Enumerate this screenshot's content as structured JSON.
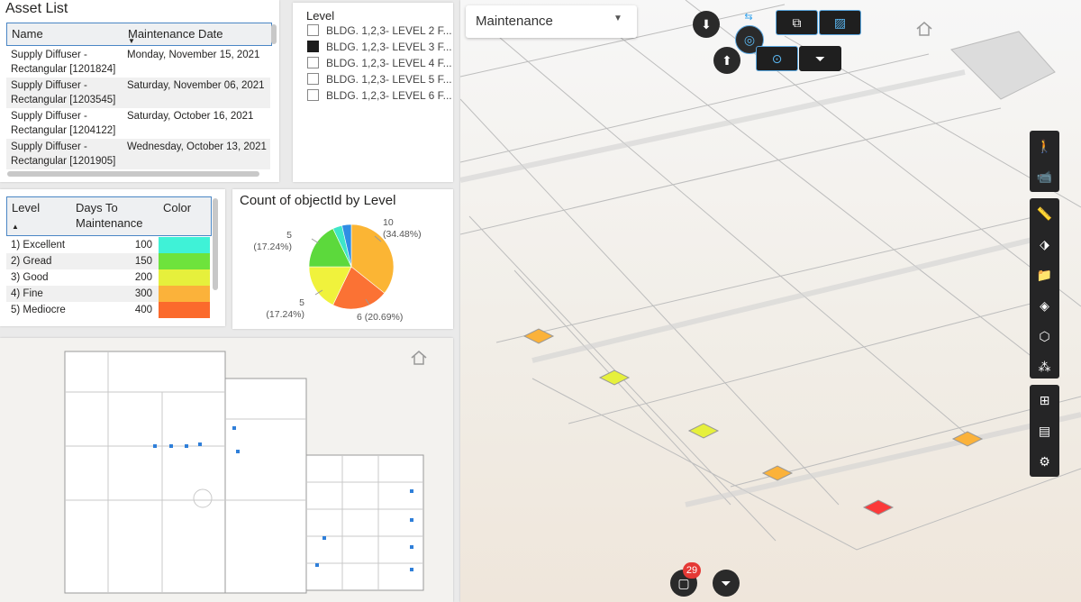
{
  "asset_list": {
    "title": "Asset List",
    "columns": [
      "Name",
      "Maintenance Date"
    ],
    "rows": [
      {
        "name_line1": "Supply Diffuser -",
        "name_line2": "Rectangular [1201824]",
        "date": "Monday, November 15, 2021"
      },
      {
        "name_line1": "Supply Diffuser -",
        "name_line2": "Rectangular [1203545]",
        "date": "Saturday, November 06, 2021"
      },
      {
        "name_line1": "Supply Diffuser -",
        "name_line2": "Rectangular [1204122]",
        "date": "Saturday, October 16, 2021"
      },
      {
        "name_line1": "Supply Diffuser -",
        "name_line2": "Rectangular [1201905]",
        "date": "Wednesday, October 13, 2021"
      }
    ]
  },
  "level_slicer": {
    "title": "Level",
    "items": [
      {
        "label": "BLDG. 1,2,3- LEVEL 2 F...",
        "checked": false
      },
      {
        "label": "BLDG. 1,2,3- LEVEL 3 F...",
        "checked": true
      },
      {
        "label": "BLDG. 1,2,3- LEVEL 4 F...",
        "checked": false
      },
      {
        "label": "BLDG. 1,2,3- LEVEL 5 F...",
        "checked": false
      },
      {
        "label": "BLDG. 1,2,3- LEVEL 6 F...",
        "checked": false
      }
    ]
  },
  "level_table": {
    "columns": [
      "Level",
      "Days To",
      "Maintenance",
      "Color"
    ],
    "rows": [
      {
        "level": "1) Excellent",
        "days": "100",
        "color": "#3ff2d7"
      },
      {
        "level": "2) Gread",
        "days": "150",
        "color": "#6ee33c"
      },
      {
        "level": "3) Good",
        "days": "200",
        "color": "#e6f03c"
      },
      {
        "level": "4) Fine",
        "days": "300",
        "color": "#fbb23a"
      },
      {
        "level": "5) Mediocre",
        "days": "400",
        "color": "#fb6a2c"
      }
    ]
  },
  "chart_data": {
    "type": "pie",
    "title": "Count of objectId by Level",
    "slices": [
      {
        "value": 10,
        "pct": "(34.48%)",
        "color": "#fbb534"
      },
      {
        "value": 6,
        "pct": "(20.69%)",
        "color": "#fb7234"
      },
      {
        "value": 5,
        "pct": "(17.24%)",
        "color": "#f0f23c"
      },
      {
        "value": 5,
        "pct": "(17.24%)",
        "color": "#5cd93c"
      },
      {
        "value": 1,
        "pct": "",
        "color": "#3ee6c8"
      },
      {
        "value": 1,
        "pct": "",
        "color": "#2f8de4"
      }
    ]
  },
  "viewer": {
    "dropdown_value": "Maintenance",
    "badge_count": "29",
    "diffuser_colors": [
      "#fbb23a",
      "#e6f03c",
      "#e6f03c",
      "#fbb23a",
      "#fbb23a",
      "#fb3a3a"
    ]
  },
  "icons": {
    "home": "home-icon",
    "person": "person-icon",
    "camera": "camera-icon",
    "measure": "ruler-icon",
    "explode": "explode-icon",
    "folder": "folder-icon",
    "layers": "layers-icon",
    "cube": "cube-icon",
    "molecule": "molecule-icon",
    "tree": "tree-icon",
    "properties": "properties-icon",
    "settings": "gear-icon"
  }
}
